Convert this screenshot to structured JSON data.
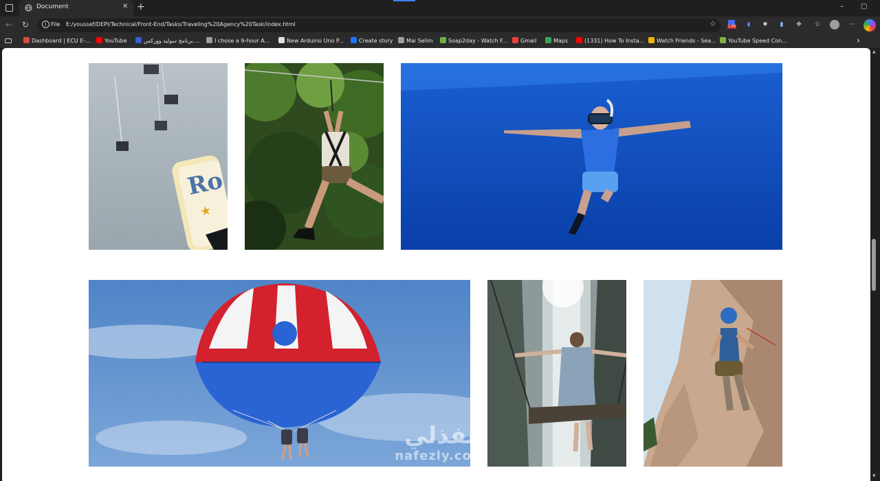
{
  "tab": {
    "title": "Document",
    "close": "✕",
    "new": "+"
  },
  "window": {
    "minimize": "–",
    "maximize": "▢"
  },
  "nav": {
    "back": "←",
    "reload": "↻",
    "info": "i",
    "star": "☆"
  },
  "address": {
    "scheme": "File",
    "url": "E:/youssef/DEPI/Technical/Front-End/Tasks/Traveling%20Agency%20Task/index.html"
  },
  "extensions": {
    "badge": "1.80",
    "menu": "···"
  },
  "bookmarks": [
    {
      "label": "Dashboard | ECU E-...",
      "color": "#d9493b"
    },
    {
      "label": "YouTube",
      "color": "#ff0000"
    },
    {
      "label": "برنامج سوليد ووركس....",
      "color": "#3a5bd9"
    },
    {
      "label": "I chose a 9-hour A...",
      "color": "#9e9e9e"
    },
    {
      "label": "New Arduino Uno P...",
      "color": "#e0e0e0"
    },
    {
      "label": "Create story",
      "color": "#1877f2"
    },
    {
      "label": "Mai Selim",
      "color": "#9e9e9e"
    },
    {
      "label": "Soap2day - Watch F...",
      "color": "#6ab04c"
    },
    {
      "label": "Gmail",
      "color": "#ea4335"
    },
    {
      "label": "Maps",
      "color": "#34a853"
    },
    {
      "label": "(1331) How To Insta...",
      "color": "#ff0000"
    },
    {
      "label": "Watch Friends - Sea...",
      "color": "#f5b400"
    },
    {
      "label": "YouTube Speed Con...",
      "color": "#7cb342"
    }
  ],
  "bookmarks_more": "›",
  "watermark": {
    "arabic": "نفذلي",
    "latin": "nafezly.com"
  }
}
